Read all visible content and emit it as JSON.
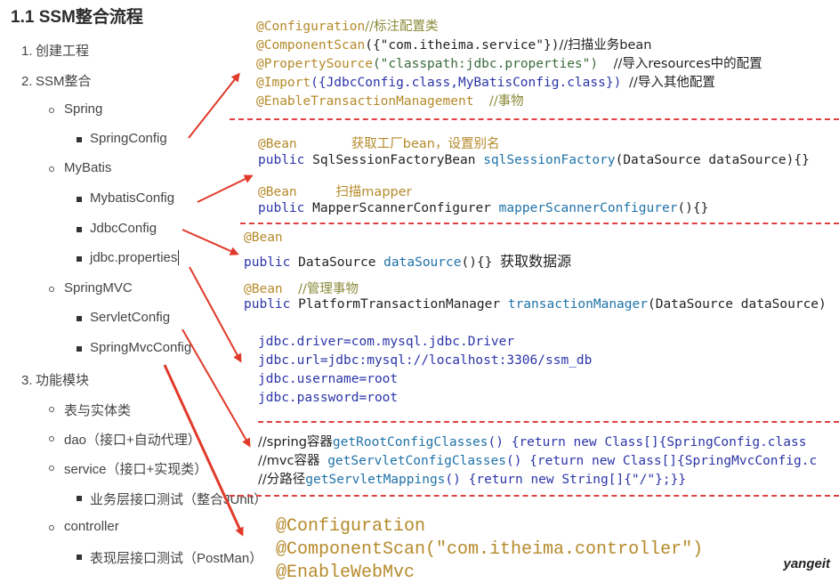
{
  "title": "1.1 SSM整合流程",
  "outline": {
    "item1": {
      "num": "1.",
      "label": "创建工程"
    },
    "item2": {
      "num": "2.",
      "label": "SSM整合"
    },
    "spring": "Spring",
    "spring_config": "SpringConfig",
    "mybatis": "MyBatis",
    "mybatis_config": "MybatisConfig",
    "jdbc_config": "JdbcConfig",
    "jdbc_properties": "jdbc.properties",
    "springmvc": "SpringMVC",
    "servlet_config": "ServletConfig",
    "springmvc_config": "SpringMvcConfig",
    "item3": {
      "num": "3.",
      "label": "功能模块"
    },
    "table_entity": "表与实体类",
    "dao": "dao（接口+自动代理）",
    "service": "service（接口+实现类）",
    "service_test": "业务层接口测试（整合JUnit）",
    "controller": "controller",
    "controller_test": "表现层接口测试（PostMan）"
  },
  "code": {
    "spring": {
      "l1_ann": "@Configuration",
      "l1_cmt": "//标注配置类",
      "l2_ann": "@ComponentScan",
      "l2_rest": "({\"com.itheima.service\"})",
      "l2_cmt": "//扫描业务bean",
      "l3_ann": "@PropertySource",
      "l3_rest": "(\"classpath:jdbc.properties\")",
      "l3_cmt": "//导入resources中的配置",
      "l4_ann": "@Import",
      "l4_rest": "({JdbcConfig.class,MyBatisConfig.class})",
      "l4_cmt": "//导入其他配置",
      "l5_ann": "@EnableTransactionManagement",
      "l5_cmt": "//事物"
    },
    "mybatis": {
      "l1_ann": "@Bean",
      "l1_cmt": "获取工厂bean，设置别名",
      "l2_kw": "public",
      "l2_type": "SqlSessionFactoryBean",
      "l2_fn": "sqlSessionFactory",
      "l2_rest": "(DataSource dataSource){}",
      "l3_ann": "@Bean",
      "l3_cmt": "扫描mapper",
      "l4_kw": "public",
      "l4_type": "MapperScannerConfigurer",
      "l4_fn": "mapperScannerConfigurer",
      "l4_rest": "(){}"
    },
    "jdbc": {
      "l1_ann": "@Bean",
      "l2_kw": "public",
      "l2_type": "DataSource",
      "l2_fn": "dataSource",
      "l2_rest": "(){}",
      "l2_cmt": "获取数据源",
      "l3_ann": "@Bean",
      "l3_cmt": "//管理事物",
      "l4_kw": "public",
      "l4_type": "PlatformTransactionManager",
      "l4_fn": "transactionManager",
      "l4_rest": "(DataSource dataSource)"
    },
    "props": {
      "l1": "jdbc.driver=com.mysql.jdbc.Driver",
      "l2": "jdbc.url=jdbc:mysql://localhost:3306/ssm_db",
      "l3": "jdbc.username=root",
      "l4": "jdbc.password=root"
    },
    "servlet": {
      "l1_cmt": "//spring容器",
      "l1_fn": "getRootConfigClasses",
      "l1_rest": "() {return new Class[]{SpringConfig.class",
      "l2_cmt": "//mvc容器",
      "l2_fn": "getServletConfigClasses",
      "l2_rest": "() {return new Class[]{SpringMvcConfig.c",
      "l3_cmt": "//分路径",
      "l3_fn": "getServletMappings",
      "l3_rest": "() {return new String[]{\"/\"};}}"
    },
    "mvc": {
      "l1": "@Configuration",
      "l2": "@ComponentScan(\"com.itheima.controller\")",
      "l3": "@EnableWebMvc"
    }
  },
  "watermark": "yangeit",
  "colors": {
    "arrow": "#e03a2a",
    "dash": "#e04040",
    "annotation": "#b58a2a",
    "keyword": "#2b35a8"
  }
}
